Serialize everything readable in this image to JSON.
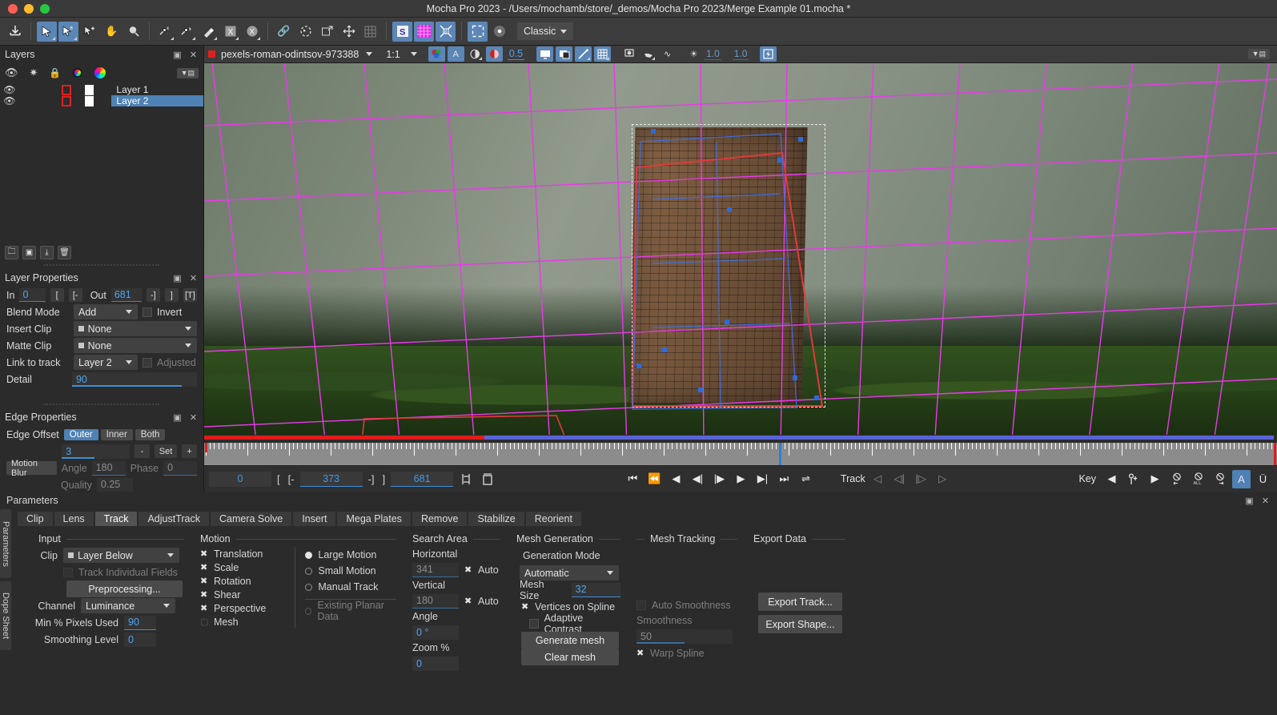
{
  "window": {
    "title": "Mocha Pro 2023 - /Users/mochamb/store/_demos/Mocha Pro 2023/Merge Example 01.mocha *"
  },
  "toolbar": {
    "layout_preset": "Classic",
    "icons": [
      {
        "name": "import-icon",
        "glyph": "⤓",
        "selected": false
      },
      {
        "name": "pick-tool-icon",
        "glyph": "➤",
        "selected": true
      },
      {
        "name": "pick-b-tool-icon",
        "glyph": "➤",
        "selected": true
      },
      {
        "name": "add-point-tool-icon",
        "glyph": "➤",
        "selected": false
      },
      {
        "name": "pan-hand-icon",
        "glyph": "✋",
        "selected": false
      },
      {
        "name": "zoom-magnifier-icon",
        "glyph": "🔍",
        "selected": false
      },
      {
        "name": "xspline-tool-icon",
        "glyph": "✎",
        "selected": false
      },
      {
        "name": "bezier-tool-icon",
        "glyph": "✎",
        "selected": false
      },
      {
        "name": "magnetic-spline-icon",
        "glyph": "🖌",
        "selected": false
      },
      {
        "name": "xspline-rect-icon",
        "glyph": "X",
        "selected": false
      },
      {
        "name": "xspline-ellipse-icon",
        "glyph": "X",
        "selected": false
      },
      {
        "name": "link-icon",
        "glyph": "🔗",
        "selected": false
      },
      {
        "name": "transform-spline-icon",
        "glyph": "◌",
        "selected": false
      },
      {
        "name": "surface-tool-icon",
        "glyph": "⬈",
        "selected": false
      },
      {
        "name": "move-plane-icon",
        "glyph": "✛",
        "selected": false
      },
      {
        "name": "grid-tool-icon",
        "glyph": "▦",
        "selected": false
      },
      {
        "name": "show-surface-icon",
        "glyph": "S",
        "selected": true
      },
      {
        "name": "show-grid-icon",
        "glyph": "▦",
        "selected": true
      },
      {
        "name": "align-surface-icon",
        "glyph": "⤢",
        "selected": true
      },
      {
        "name": "show-planar-grid-icon",
        "glyph": "⬚",
        "selected": true
      },
      {
        "name": "stabilize-view-icon",
        "glyph": "◓",
        "selected": false
      }
    ]
  },
  "layers_panel": {
    "title": "Layers",
    "column_icons": [
      "eye-icon",
      "gear-icon",
      "lock-icon",
      "outline-color-icon",
      "fill-color-icon"
    ],
    "rows": [
      {
        "name": "Layer 1",
        "visible": true,
        "selected": false
      },
      {
        "name": "Layer 2",
        "visible": true,
        "selected": true
      }
    ],
    "footer_buttons": [
      "new-group-icon",
      "add-layer-icon",
      "import-layer-icon",
      "delete-layer-icon"
    ]
  },
  "layer_properties": {
    "title": "Layer Properties",
    "in_label": "In",
    "in_value": "0",
    "out_label": "Out",
    "out_value": "681",
    "range_buttons": [
      "[",
      "[-",
      "-]",
      "]",
      "[T]"
    ],
    "blend_mode_label": "Blend Mode",
    "blend_mode_value": "Add",
    "invert_label": "Invert",
    "insert_clip_label": "Insert Clip",
    "insert_clip_value": "None",
    "matte_clip_label": "Matte Clip",
    "matte_clip_value": "None",
    "link_to_track_label": "Link to track",
    "link_to_track_value": "Layer 2",
    "adjusted_label": "Adjusted",
    "detail_label": "Detail",
    "detail_value": "90"
  },
  "edge_properties": {
    "title": "Edge Properties",
    "edge_offset_label": "Edge Offset",
    "edge_offset_options": [
      "Outer",
      "Inner",
      "Both"
    ],
    "edge_offset_selected": "Outer",
    "offset_value": "3",
    "minus_label": "-",
    "set_label": "Set",
    "plus_label": "+",
    "motion_blur_label": "Motion Blur",
    "angle_label": "Angle",
    "angle_value": "180",
    "phase_label": "Phase",
    "phase_value": "0",
    "quality_label": "Quality",
    "quality_value": "0.25"
  },
  "viewer_toolbar": {
    "clip_name": "pexels-roman-odintsov-973388",
    "zoom_level": "1:1",
    "opacity_value": "0.5",
    "gamma_value": "1.0",
    "exposure_value": "1.0",
    "icons": [
      {
        "name": "channel-rgb-icon",
        "glyph": "◕",
        "selected": true
      },
      {
        "name": "matte-alpha-icon",
        "glyph": "A",
        "selected": true
      },
      {
        "name": "overlay-toggle-icon",
        "glyph": "◑",
        "selected": false
      },
      {
        "name": "mask-overlay-icon",
        "glyph": "◍",
        "selected": true
      },
      {
        "name": "monitor-output-icon",
        "glyph": "🖵",
        "selected": true
      },
      {
        "name": "layer-compare-icon",
        "glyph": "◧",
        "selected": true
      },
      {
        "name": "spline-overlay-icon",
        "glyph": "✎",
        "selected": true
      },
      {
        "name": "grid-overlay-icon",
        "glyph": "▦",
        "selected": true
      },
      {
        "name": "preview-icon",
        "glyph": "◉",
        "selected": false
      },
      {
        "name": "manual-track-icon",
        "glyph": "☟",
        "selected": false
      },
      {
        "name": "curve-icon",
        "glyph": "∿",
        "selected": false
      },
      {
        "name": "brightness-icon",
        "glyph": "☀",
        "selected": false
      },
      {
        "name": "gpu-icon",
        "glyph": "⚡",
        "selected": true
      }
    ],
    "panel_menu_icon": "panel-menu-icon"
  },
  "timeline": {
    "current_frame": "0",
    "in_point": "373",
    "out_point": "681",
    "in_bracket": "[",
    "in_bracket2": "[-",
    "out_bracket": "-]",
    "out_bracket2": "]",
    "track_label": "Track",
    "key_label": "Key",
    "transport_icons": [
      "go-to-start-icon",
      "previous-keyframe-icon",
      "play-backward-icon",
      "step-back-icon",
      "step-forward-icon",
      "play-forward-icon",
      "next-keyframe-icon",
      "go-to-end-icon",
      "loop-icon"
    ],
    "track_icons": [
      "track-backward-icon",
      "track-back-frame-icon",
      "track-forward-frame-icon",
      "track-forward-icon"
    ],
    "key_icons": [
      "prev-key-icon",
      "add-key-icon",
      "next-key-icon",
      "delete-key-icon",
      "delete-all-keys-icon",
      "delete-keys-after-icon"
    ],
    "auto_key_label": "A",
    "undo_key_label": "Ü"
  },
  "parameters": {
    "title": "Parameters",
    "side_tabs": [
      "Parameters",
      "Dope Sheet"
    ],
    "tabs": [
      "Clip",
      "Lens",
      "Track",
      "AdjustTrack",
      "Camera Solve",
      "Insert",
      "Mega Plates",
      "Remove",
      "Stabilize",
      "Reorient"
    ],
    "active_tab": "Track",
    "input": {
      "heading": "Input",
      "clip_label": "Clip",
      "clip_value": "Layer Below",
      "track_individual_fields_label": "Track Individual Fields",
      "preprocessing_label": "Preprocessing...",
      "channel_label": "Channel",
      "channel_value": "Luminance",
      "min_pixels_label": "Min % Pixels Used",
      "min_pixels_value": "90",
      "smoothing_level_label": "Smoothing Level",
      "smoothing_level_value": "0"
    },
    "motion": {
      "heading": "Motion",
      "checkboxes": [
        {
          "label": "Translation",
          "checked": true
        },
        {
          "label": "Scale",
          "checked": true
        },
        {
          "label": "Rotation",
          "checked": true
        },
        {
          "label": "Shear",
          "checked": true
        },
        {
          "label": "Perspective",
          "checked": true
        },
        {
          "label": "Mesh",
          "checked": false
        }
      ],
      "radios": [
        {
          "label": "Large Motion",
          "selected": true
        },
        {
          "label": "Small Motion",
          "selected": false
        },
        {
          "label": "Manual Track",
          "selected": false
        }
      ],
      "existing_planar_data_label": "Existing Planar Data"
    },
    "search_area": {
      "heading": "Search Area",
      "horizontal_label": "Horizontal",
      "horizontal_value": "341",
      "horizontal_auto_label": "Auto",
      "vertical_label": "Vertical",
      "vertical_value": "180",
      "vertical_auto_label": "Auto",
      "angle_label": "Angle",
      "angle_value": "0 °",
      "zoom_label": "Zoom %",
      "zoom_value": "0"
    },
    "mesh_generation": {
      "heading": "Mesh Generation",
      "generation_mode_label": "Generation Mode",
      "generation_mode_value": "Automatic",
      "mesh_size_label": "Mesh Size",
      "mesh_size_value": "32",
      "vertices_on_spline_label": "Vertices on Spline",
      "adaptive_contrast_label": "Adaptive Contrast",
      "generate_mesh_label": "Generate mesh",
      "clear_mesh_label": "Clear mesh"
    },
    "mesh_tracking": {
      "heading": "Mesh Tracking",
      "auto_smoothness_label": "Auto Smoothness",
      "smoothness_label": "Smoothness",
      "smoothness_value": "50",
      "warp_spline_label": "Warp Spline"
    },
    "export_data": {
      "heading": "Export Data",
      "export_track_label": "Export Track...",
      "export_shape_label": "Export Shape..."
    }
  },
  "colors": {
    "accent_blue": "#4e81b4",
    "value_blue": "#4ea3f0",
    "timeline_red": "#e01c1c",
    "timeline_blue": "#5a63d8",
    "spline_red": "#e03a3a",
    "mesh_magenta": "#e83ae8"
  }
}
